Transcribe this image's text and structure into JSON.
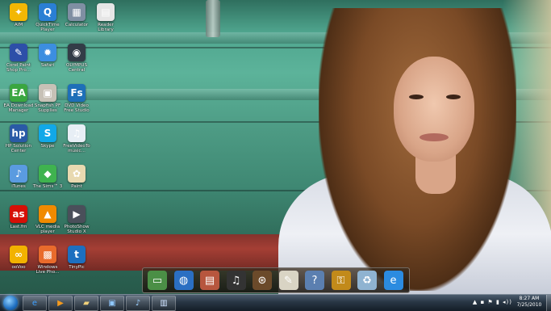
{
  "desktop": {
    "icons": [
      {
        "label": "AIM",
        "icon": "aim-running-man-icon",
        "color": "#f2b705",
        "glyph": "✦"
      },
      {
        "label": "QuickTime\nPlayer",
        "icon": "quicktime-icon",
        "color": "#2a7fd4",
        "glyph": "Q"
      },
      {
        "label": "Calculator",
        "icon": "calculator-icon",
        "color": "#7f8fa3",
        "glyph": "▦"
      },
      {
        "label": "Reader\nLibrary",
        "icon": "reader-library-icon",
        "color": "#e6e6e6",
        "glyph": "▤"
      },
      {
        "label": "Corel Paint\nShop Pro...",
        "icon": "corel-paint-shop-icon",
        "color": "#2d4fa8",
        "glyph": "✎"
      },
      {
        "label": "Safari",
        "icon": "safari-compass-icon",
        "color": "#3c8ee0",
        "glyph": "✹"
      },
      {
        "label": "OLYMPUS\nCentral",
        "icon": "olympus-camera-icon",
        "color": "#333c47",
        "glyph": "◉"
      },
      {
        "label": "EA Download\nManager",
        "icon": "ea-icon",
        "color": "#3aa640",
        "glyph": "EA"
      },
      {
        "label": "Snapfish PF\nSupplies",
        "icon": "snapfish-printer-icon",
        "color": "#c7c1b6",
        "glyph": "▣"
      },
      {
        "label": "DVD Video\nFree Studio",
        "icon": "free-studio-icon",
        "color": "#1e6fb8",
        "glyph": "Fs"
      },
      {
        "label": "HP Solution\nCenter",
        "icon": "hp-icon",
        "color": "#2a5aa6",
        "glyph": "hp"
      },
      {
        "label": "Skype",
        "icon": "skype-icon",
        "color": "#11a8e8",
        "glyph": "S"
      },
      {
        "label": "FreeVideoTo\nmusic...",
        "icon": "video-to-music-icon",
        "color": "#e7eef5",
        "glyph": "♫"
      },
      {
        "label": "iTunes",
        "icon": "itunes-icon",
        "color": "#5a9be0",
        "glyph": "♪"
      },
      {
        "label": "The Sims™ 3",
        "icon": "sims-plumbob-icon",
        "color": "#3fb34f",
        "glyph": "◆"
      },
      {
        "label": "Paint",
        "icon": "paint-palette-icon",
        "color": "#e8d9b0",
        "glyph": "✿"
      },
      {
        "label": "Last.fm",
        "icon": "lastfm-icon",
        "color": "#d51007",
        "glyph": "as"
      },
      {
        "label": "VLC media\nplayer",
        "icon": "vlc-cone-icon",
        "color": "#f08a00",
        "glyph": "▲"
      },
      {
        "label": "PhotoShow\nStudio X",
        "icon": "photoshow-icon",
        "color": "#4a4f5a",
        "glyph": "▶"
      },
      {
        "label": "ooVoo",
        "icon": "oovoo-icon",
        "color": "#f2b200",
        "glyph": "∞"
      },
      {
        "label": "Windows\nLive Pho...",
        "icon": "windows-live-photo-icon",
        "color": "#e96b2c",
        "glyph": "▩"
      },
      {
        "label": "TinyPic",
        "icon": "tinypic-icon",
        "color": "#1d6fbf",
        "glyph": "t"
      }
    ]
  },
  "dock": {
    "items": [
      {
        "icon": "photo-frame-icon",
        "color": "#4b8f46",
        "glyph": "▭"
      },
      {
        "icon": "globe-icon",
        "color": "#2b6fc2",
        "glyph": "◍"
      },
      {
        "icon": "stacked-folders-icon",
        "color": "#b7563e",
        "glyph": "▤"
      },
      {
        "icon": "headphones-icon",
        "color": "#333333",
        "glyph": "♫"
      },
      {
        "icon": "film-reel-icon",
        "color": "#6b4a2a",
        "glyph": "⊛"
      },
      {
        "icon": "notepad-pencil-icon",
        "color": "#d9d4c4",
        "glyph": "✎"
      },
      {
        "icon": "help-question-icon",
        "color": "#5b7fb0",
        "glyph": "?"
      },
      {
        "icon": "padlock-icon",
        "color": "#c28a1a",
        "glyph": "⚿"
      },
      {
        "icon": "recycle-bin-icon",
        "color": "#8fb3d1",
        "glyph": "♻"
      },
      {
        "icon": "internet-explorer-icon",
        "color": "#2b8be0",
        "glyph": "e"
      }
    ]
  },
  "taskbar": {
    "pinned": [
      {
        "icon": "internet-explorer-icon",
        "glyph": "e",
        "color": "#3ea0ff"
      },
      {
        "icon": "media-player-icon",
        "glyph": "▶",
        "color": "#f39a1e"
      },
      {
        "icon": "file-explorer-icon",
        "glyph": "▰",
        "color": "#f1d17a"
      },
      {
        "icon": "desktop-window-icon",
        "glyph": "▣",
        "color": "#8fc7ff"
      },
      {
        "icon": "itunes-icon",
        "glyph": "♪",
        "color": "#9cd0ff"
      },
      {
        "icon": "window-switch-icon",
        "glyph": "▥",
        "color": "#cfe3ff"
      }
    ],
    "tray": "▲ ▪ ⚑ ▮ ◂))",
    "clock": {
      "time": "8:27 AM",
      "date": "7/25/2010"
    }
  }
}
